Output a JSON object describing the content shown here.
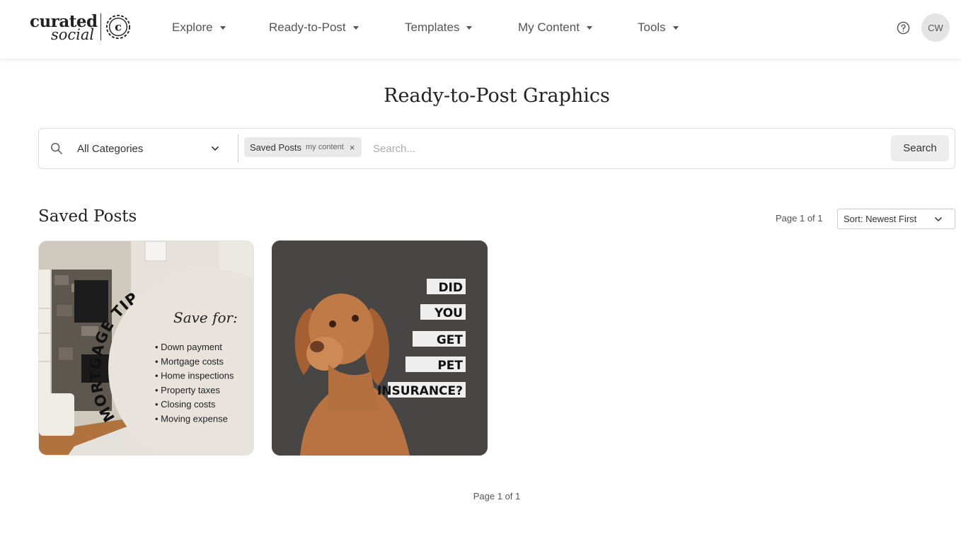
{
  "header": {
    "logo_line1": "curated",
    "logo_line2": "social",
    "nav": [
      {
        "label": "Explore"
      },
      {
        "label": "Ready-to-Post"
      },
      {
        "label": "Templates"
      },
      {
        "label": "My Content"
      },
      {
        "label": "Tools"
      }
    ],
    "avatar_initials": "CW"
  },
  "page_title": "Ready-to-Post Graphics",
  "search": {
    "category": "All Categories",
    "chip_label": "Saved Posts",
    "chip_sub": "my content",
    "chip_remove": "×",
    "placeholder": "Search...",
    "button_label": "Search"
  },
  "section": {
    "title": "Saved Posts",
    "page_info": "Page 1 of 1",
    "sort_label": "Sort: Newest First"
  },
  "cards": [
    {
      "heading": "MORTGAGE TIP",
      "subheading": "Save for:",
      "items": [
        "• Down payment",
        "• Mortgage costs",
        "• Home inspections",
        "• Property taxes",
        "• Closing costs",
        "• Moving expense"
      ]
    },
    {
      "lines": [
        "DID",
        "YOU",
        "GET",
        "PET",
        "INSURANCE?"
      ]
    }
  ],
  "footer": {
    "page_info": "Page 1 of 1"
  },
  "colors": {
    "accent": "#222222",
    "card2_bg": "#474645",
    "chip_bg": "#e9e9e9"
  }
}
